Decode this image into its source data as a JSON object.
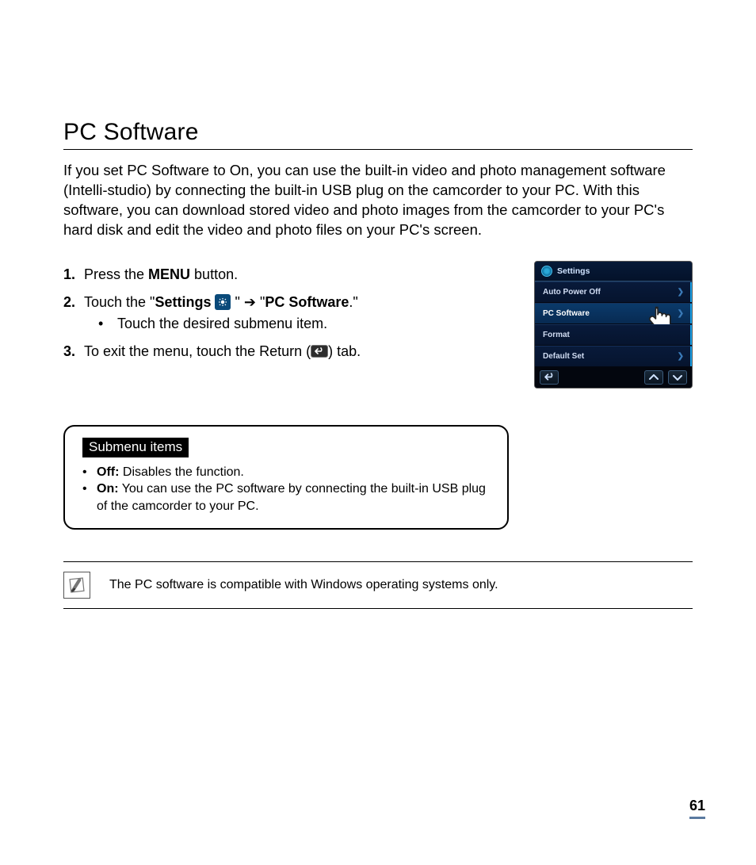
{
  "title": "PC Software",
  "intro": "If you set PC Software to On, you can use the built-in video and photo management software (Intelli-studio) by connecting the built-in USB plug on the camcorder to your PC. With this software, you can download stored video and photo images from the camcorder to your PC's hard disk and edit the video and photo files on your PC's screen.",
  "steps": {
    "s1": {
      "num": "1.",
      "pre": "Press the ",
      "bold": "MENU",
      "post": " button."
    },
    "s2": {
      "num": "2.",
      "pre": "Touch the \"",
      "bold1": "Settings",
      "mid": " \"  ➔  \"",
      "bold2": "PC Software",
      "post": ".\"",
      "sub": "Touch the desired submenu item."
    },
    "s3": {
      "num": "3.",
      "pre": "To exit the menu, touch the Return (",
      "post": ") tab."
    }
  },
  "device": {
    "header": "Settings",
    "rows": [
      "Auto Power Off",
      "PC Software",
      "Format",
      "Default Set"
    ]
  },
  "submenu": {
    "title": "Submenu items",
    "off_label": "Off:",
    "off_text": " Disables the function.",
    "on_label": "On:",
    "on_text": " You can use the PC software by connecting the built-in USB plug of the camcorder to your PC."
  },
  "note": "The PC software is compatible with Windows operating systems only.",
  "page_number": "61"
}
